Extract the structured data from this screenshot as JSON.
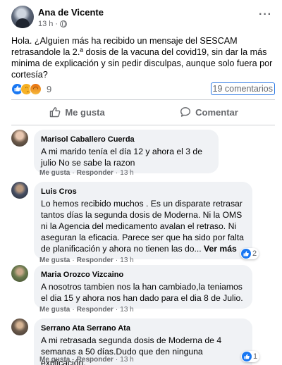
{
  "post": {
    "author": "Ana de Vicente",
    "time": "13 h",
    "text": "Hola. ¿Alguien más ha recibido un mensaje del SESCAM retrasandole la 2.ª dosis de la vacuna del covid19, sin dar la más minima de explicación y sin pedir disculpas, aunque solo fuera por cortesía?",
    "reaction_count": "9",
    "comment_count": "19 comentarios",
    "icons": [
      "globe-icon",
      "more-icon",
      "like-reaction-icon",
      "sad-reaction-icon",
      "angry-reaction-icon"
    ]
  },
  "actions": {
    "like_label": "Me gusta",
    "comment_label": "Comentar"
  },
  "comments": [
    {
      "name": "Marisol Caballero Cuerda",
      "text": "A mi marido tenía el día 12 y ahora el 3 de julio No se sabe la razon",
      "like": "Me gusta",
      "reply": "Responder",
      "time": "13 h"
    },
    {
      "name": "Luis Cros",
      "text": "Lo hemos recibido muchos . Es un disparate retrasar tantos días la segunda dosis de Moderna. Ni la OMS ni la Agencia del medicamento avalan el retraso. Ni aseguran la eficacia. Parece ser que ha sido por falta de planificación y ahora no tienen las do...",
      "see_more": "Ver más",
      "like": "Me gusta",
      "reply": "Responder",
      "time": "13 h",
      "reactions": "2"
    },
    {
      "name": "Maria Orozco Vizcaino",
      "text": "A nosotros tambien nos la han cambiado,la teniamos el dia 15 y ahora nos han dado para el dia 8 de Julio.",
      "like": "Me gusta",
      "reply": "Responder",
      "time": "13 h"
    },
    {
      "name": "Serrano Ata Serrano Ata",
      "text": "A mi retrasada segunda dosis de Moderna de 4 semanas a 50 días.Dudo que den ninguna explicación.",
      "like": "Me gusta",
      "reply": "Responder",
      "time": "13 h",
      "reactions": "1"
    }
  ],
  "separator": "·",
  "colors": {
    "accent": "#1877f2",
    "muted": "#65676b",
    "bubble": "#f0f2f5"
  }
}
